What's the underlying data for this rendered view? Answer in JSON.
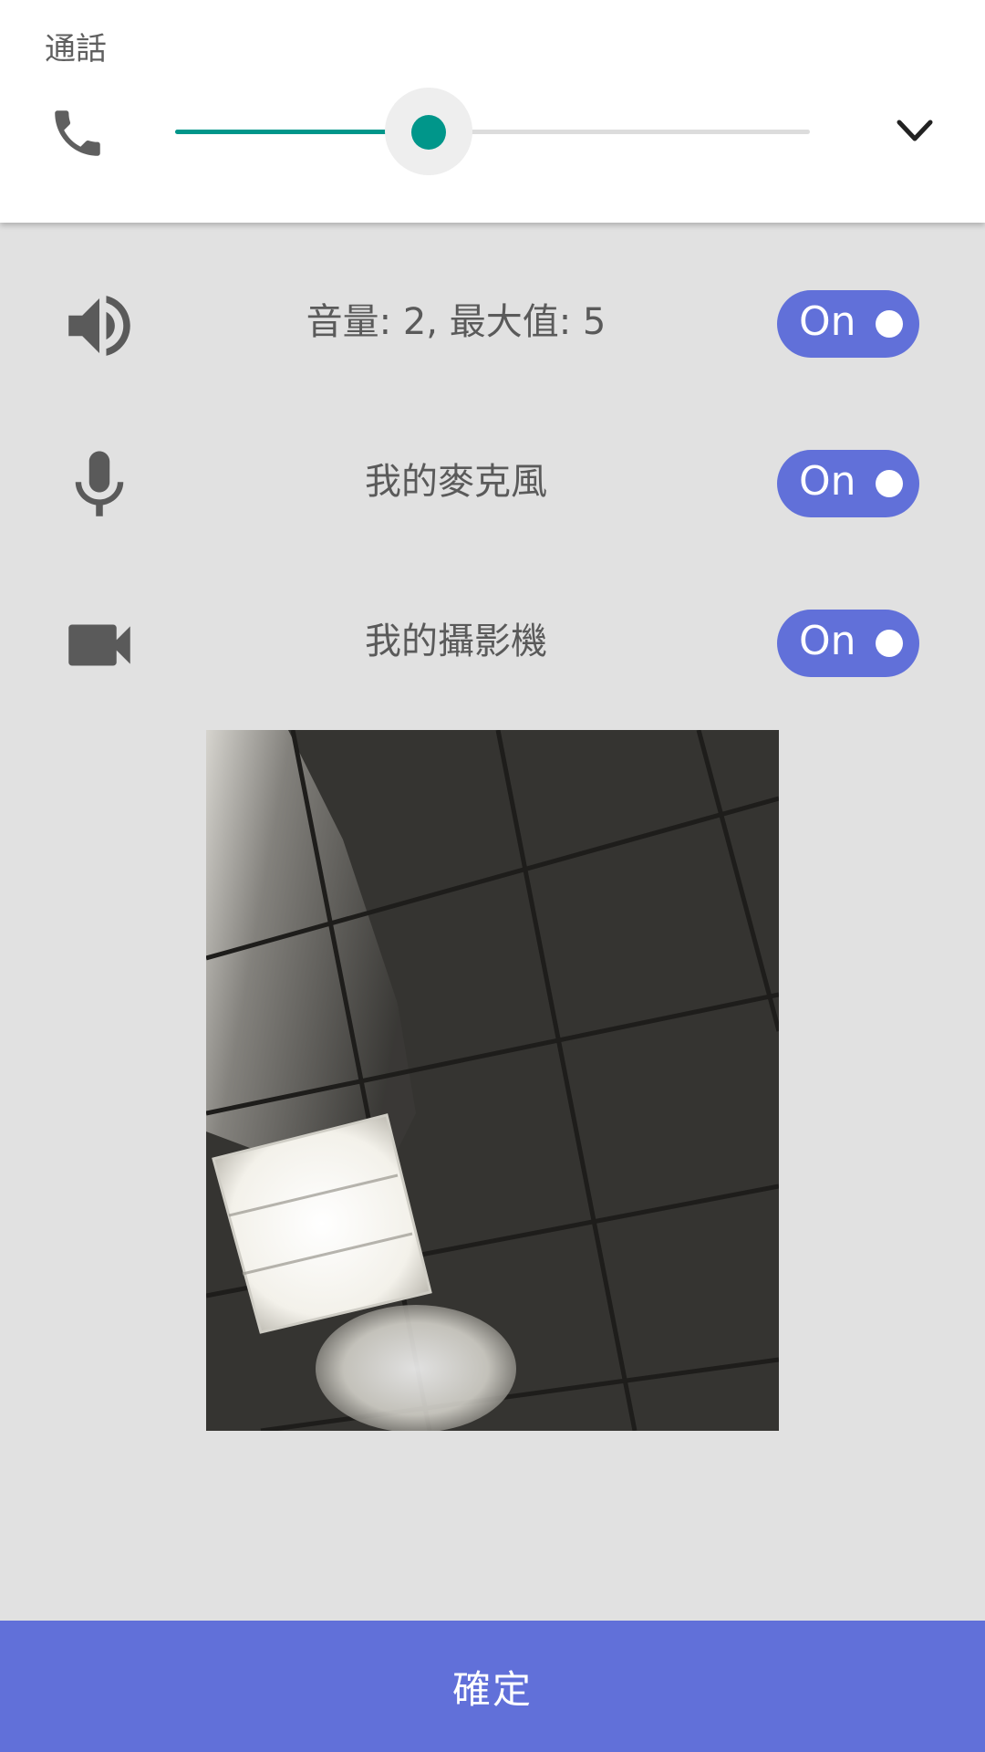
{
  "volume_panel": {
    "title": "通話",
    "stream_icon": "phone-icon",
    "slider_value": 2,
    "slider_max": 5,
    "accent_color": "#00968a",
    "expand_icon": "chevron-down-icon"
  },
  "settings": {
    "rows": [
      {
        "icon": "speaker-icon",
        "label": "音量: 2, 最大值: 5",
        "toggle": "On"
      },
      {
        "icon": "microphone-icon",
        "label": "我的麥克風",
        "toggle": "On"
      },
      {
        "icon": "videocam-icon",
        "label": "我的攝影機",
        "toggle": "On"
      }
    ],
    "toggle_color": "#6170d9"
  },
  "camera_preview": {
    "content": "camera-preview-image"
  },
  "confirm": {
    "label": "確定",
    "color": "#6170d9"
  }
}
